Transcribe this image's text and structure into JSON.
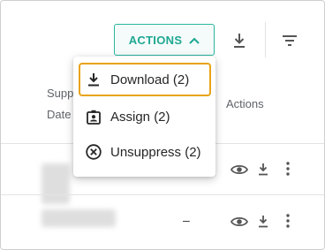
{
  "toolbar": {
    "actions_label": "ACTIONS",
    "accent_color": "#1fa792"
  },
  "table": {
    "headers": {
      "suppressed_date_line1": "Supp",
      "suppressed_date_line2": "Date",
      "actions": "Actions"
    },
    "rows": [
      {
        "suppressed_date": ""
      },
      {
        "suppressed_date": "–"
      }
    ]
  },
  "menu": {
    "items": [
      {
        "label": "Download (2)",
        "icon": "download-icon"
      },
      {
        "label": "Assign (2)",
        "icon": "assign-badge-icon"
      },
      {
        "label": "Unsuppress (2)",
        "icon": "unsuppress-icon"
      }
    ],
    "highlight_color": "#e9a316"
  }
}
